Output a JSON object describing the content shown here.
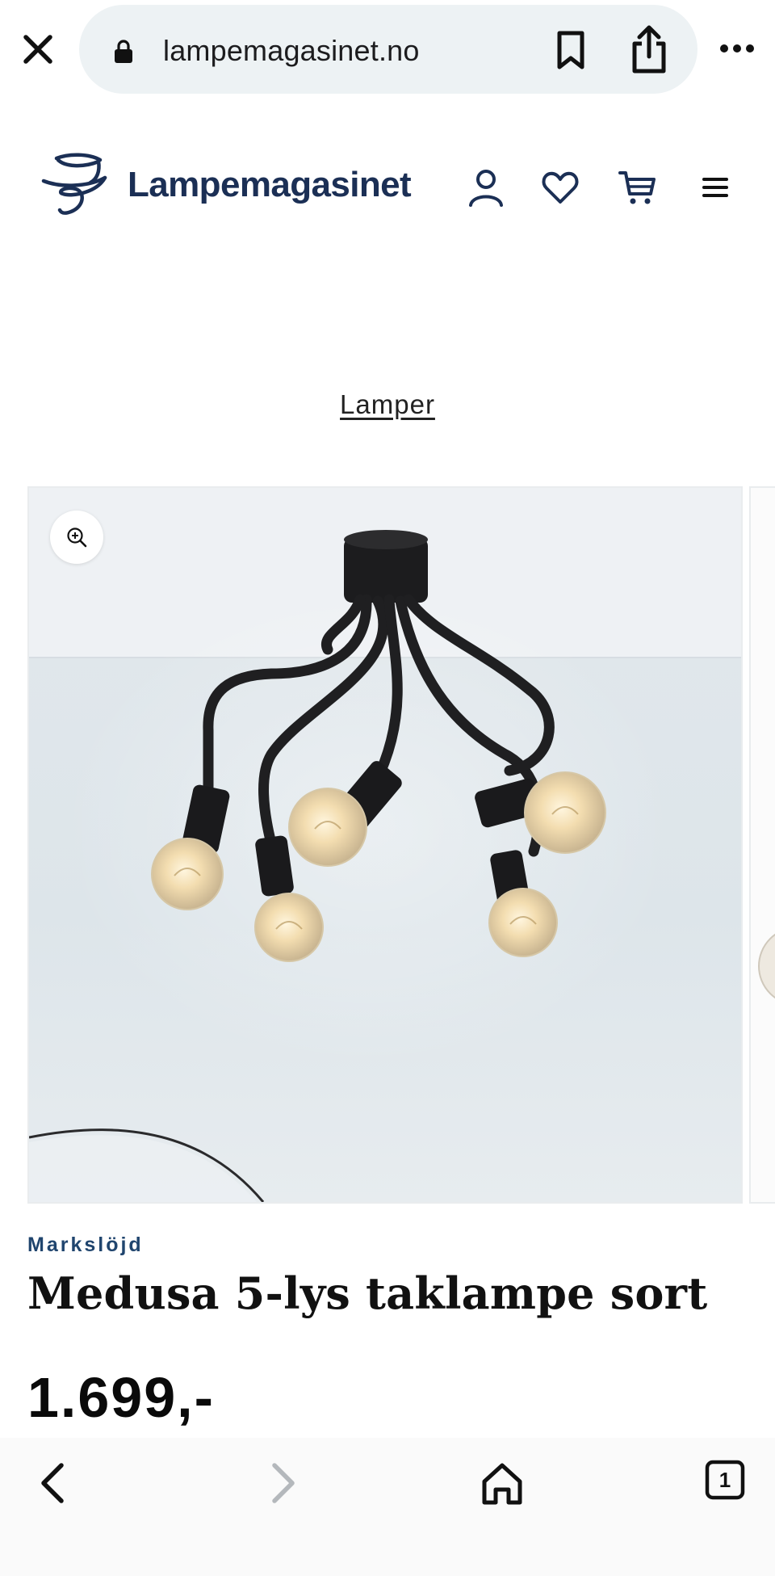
{
  "browser": {
    "url": "lampemagasinet.no",
    "tab_count": "1"
  },
  "site": {
    "brand": "Lampemagasinet"
  },
  "breadcrumb": {
    "label": "Lamper"
  },
  "product": {
    "brand": "Markslöjd",
    "title": "Medusa 5-lys taklampe sort",
    "price": "1.699,-"
  },
  "colors": {
    "brand_navy": "#1b2f55",
    "brand_label": "#20456e",
    "url_pill_bg": "#edf2f4"
  },
  "icons": {
    "close": "close-icon",
    "lock": "lock-icon",
    "bookmark": "bookmark-icon",
    "share": "share-icon",
    "more": "more-icon",
    "account": "user-icon",
    "wishlist": "heart-icon",
    "cart": "cart-icon",
    "menu": "hamburger-icon",
    "zoom": "zoom-in-icon",
    "back": "chevron-left-icon",
    "forward": "chevron-right-icon",
    "home": "home-icon",
    "tabs": "tabs-icon"
  }
}
